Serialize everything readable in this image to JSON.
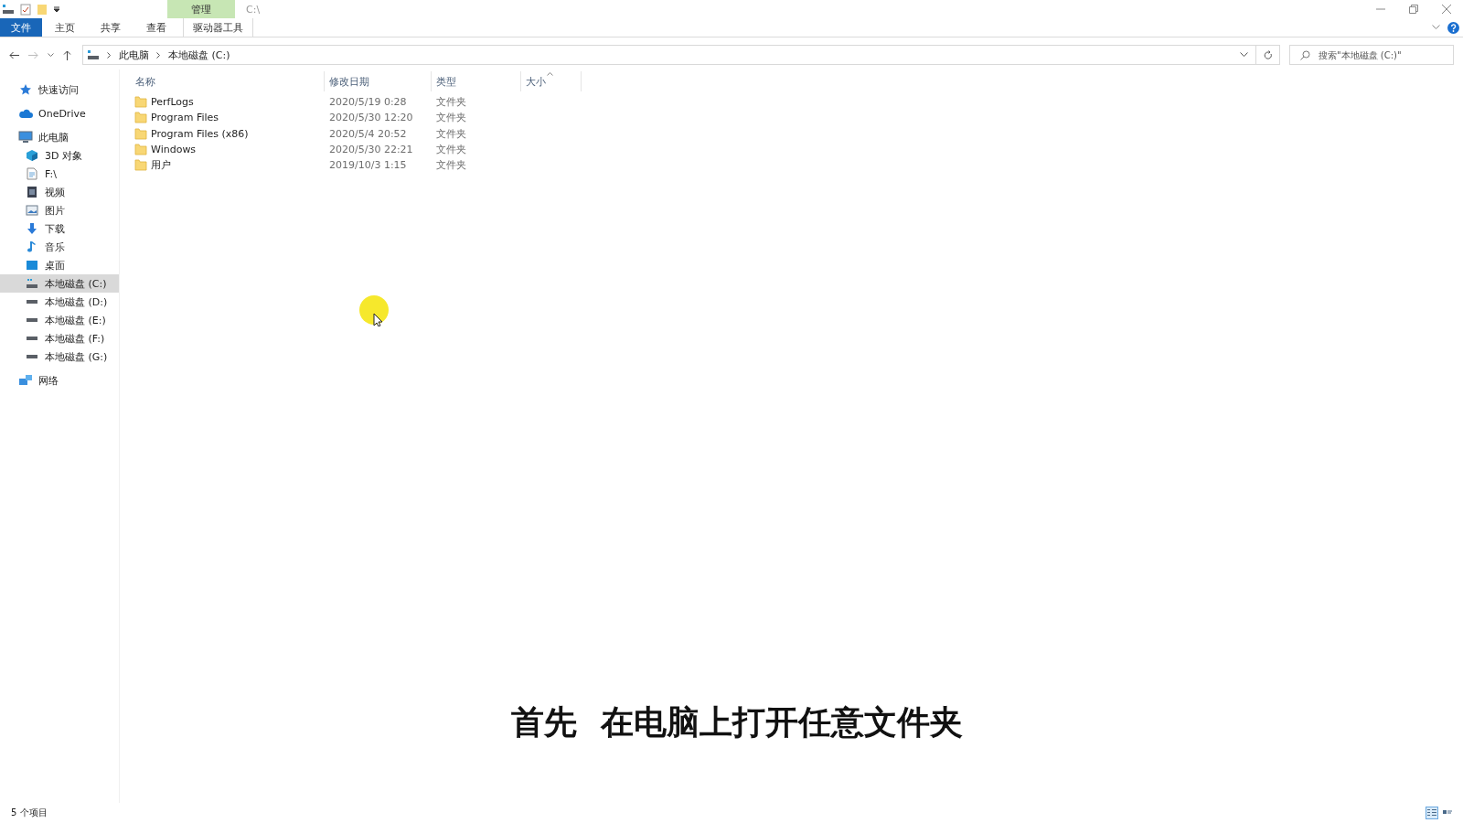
{
  "title_bar": {
    "context_tab": "管理",
    "path": "C:\\"
  },
  "ribbon": {
    "tabs": [
      {
        "label": "文件",
        "kind": "file"
      },
      {
        "label": "主页",
        "kind": "plain"
      },
      {
        "label": "共享",
        "kind": "plain"
      },
      {
        "label": "查看",
        "kind": "plain"
      },
      {
        "label": "驱动器工具",
        "kind": "context"
      }
    ]
  },
  "address_bar": {
    "crumbs": [
      "此电脑",
      "本地磁盘 (C:)"
    ]
  },
  "search": {
    "placeholder": "搜索\"本地磁盘 (C:)\""
  },
  "sidebar": {
    "items": [
      {
        "label": "快速访问",
        "kind": "star",
        "selected": false
      },
      {
        "label": "OneDrive",
        "kind": "cloud",
        "selected": false
      },
      {
        "label": "此电脑",
        "kind": "pc",
        "selected": false,
        "children": [
          {
            "label": "3D 对象",
            "kind": "cube",
            "selected": false
          },
          {
            "label": "F:\\",
            "kind": "file",
            "selected": false
          },
          {
            "label": "视频",
            "kind": "video",
            "selected": false
          },
          {
            "label": "图片",
            "kind": "picture",
            "selected": false
          },
          {
            "label": "下载",
            "kind": "download",
            "selected": false
          },
          {
            "label": "音乐",
            "kind": "music",
            "selected": false
          },
          {
            "label": "桌面",
            "kind": "desktop",
            "selected": false
          },
          {
            "label": "本地磁盘 (C:)",
            "kind": "system-drive",
            "selected": true
          },
          {
            "label": "本地磁盘 (D:)",
            "kind": "drive",
            "selected": false
          },
          {
            "label": "本地磁盘 (E:)",
            "kind": "drive",
            "selected": false
          },
          {
            "label": "本地磁盘 (F:)",
            "kind": "drive",
            "selected": false
          },
          {
            "label": "本地磁盘 (G:)",
            "kind": "drive",
            "selected": false
          }
        ]
      },
      {
        "label": "网络",
        "kind": "network",
        "selected": false
      }
    ]
  },
  "file_list": {
    "columns": [
      {
        "label": "名称",
        "sorted": false
      },
      {
        "label": "修改日期",
        "sorted": false
      },
      {
        "label": "类型",
        "sorted": false
      },
      {
        "label": "大小",
        "sorted": true
      }
    ],
    "rows": [
      {
        "name": "PerfLogs",
        "modified": "2020/5/19 0:28",
        "type": "文件夹"
      },
      {
        "name": "Program Files",
        "modified": "2020/5/30 12:20",
        "type": "文件夹"
      },
      {
        "name": "Program Files (x86)",
        "modified": "2020/5/4 20:52",
        "type": "文件夹"
      },
      {
        "name": "Windows",
        "modified": "2020/5/30 22:21",
        "type": "文件夹"
      },
      {
        "name": "用户",
        "modified": "2019/10/3 1:15",
        "type": "文件夹"
      }
    ]
  },
  "status_bar": {
    "count": "5 个项目",
    "views": [
      {
        "kind": "details",
        "selected": true
      },
      {
        "kind": "tiles",
        "selected": false
      }
    ]
  },
  "subtitle": "首先 在电脑上打开任意文件夹"
}
